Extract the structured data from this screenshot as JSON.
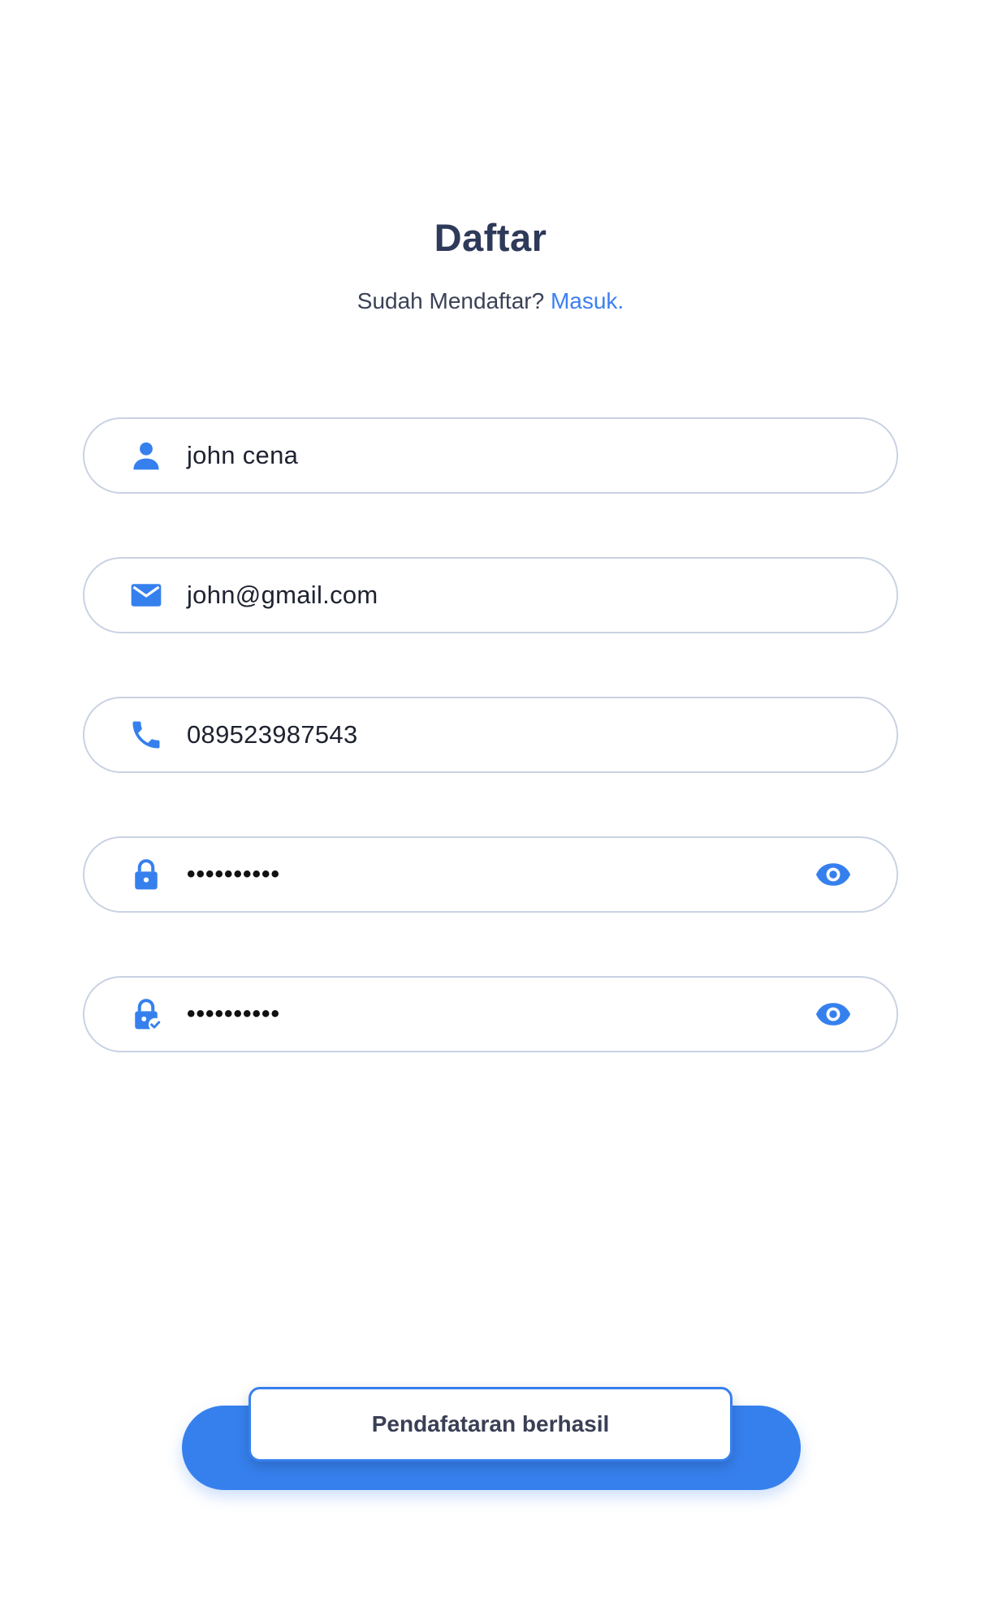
{
  "header": {
    "title": "Daftar",
    "subtitle_text": "Sudah Mendaftar?",
    "login_link": "Masuk."
  },
  "form": {
    "name": {
      "value": "john cena",
      "icon": "person-icon"
    },
    "email": {
      "value": "john@gmail.com",
      "icon": "mail-icon"
    },
    "phone": {
      "value": "089523987543",
      "icon": "phone-icon"
    },
    "password": {
      "value": "••••••••••",
      "icon": "lock-icon",
      "toggle_icon": "eye-icon"
    },
    "confirm_password": {
      "value": "••••••••••",
      "icon": "lock-check-icon",
      "toggle_icon": "eye-icon"
    }
  },
  "toast": {
    "message": "Pendafataran berhasil"
  },
  "colors": {
    "accent": "#3680ee",
    "field_border": "#c9d2e3",
    "title": "#2e3a59",
    "link": "#3d7ff0"
  }
}
